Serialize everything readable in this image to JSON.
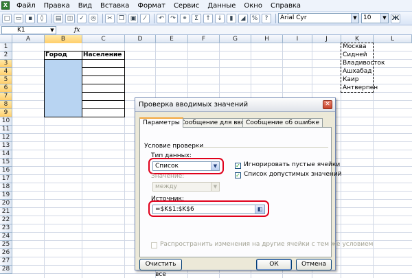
{
  "menubar": {
    "app_icon": "excel-icon",
    "items": [
      "Файл",
      "Правка",
      "Вид",
      "Вставка",
      "Формат",
      "Сервис",
      "Данные",
      "Окно",
      "Справка"
    ]
  },
  "toolbar": {
    "font_name": "Arial Cyr",
    "font_size": "10",
    "sigma": "Σ",
    "bold": "Ж"
  },
  "formula_bar": {
    "name_box": "K1",
    "fx": "fx"
  },
  "grid": {
    "columns": [
      "A",
      "B",
      "C",
      "D",
      "E",
      "F",
      "G",
      "H",
      "I",
      "J",
      "K",
      "L"
    ],
    "selected_column": "B",
    "rows": [
      "1",
      "2",
      "3",
      "4",
      "5",
      "6",
      "7",
      "8",
      "9",
      "10",
      "11",
      "12",
      "13",
      "14",
      "15",
      "16",
      "17",
      "18",
      "19",
      "20",
      "21",
      "22",
      "23"
    ],
    "header_city": "Город",
    "header_population": "Население",
    "list_cities": [
      "Москва",
      "Сидней",
      "Владивосток",
      "Ашхабад",
      "Каир",
      "Антверпен"
    ]
  },
  "dialog": {
    "title": "Проверка вводимых значений",
    "tabs": [
      "Параметры",
      "Сообщение для ввода",
      "Сообщение об ошибке"
    ],
    "section_label": "Условие проверки",
    "type_label": "Тип данных:",
    "type_value": "Список",
    "value_label": "Значение:",
    "value_value": "между",
    "ignore_blank_label": "Игнорировать пустые ячейки",
    "dropdown_list_label": "Список допустимых значений",
    "source_label": "Источник:",
    "source_value": "=$K$1:$K$6",
    "apply_all_label": "Распространить изменения на другие ячейки с тем же условием",
    "clear_all_label": "Очистить все",
    "ok_label": "ОК",
    "cancel_label": "Отмена"
  },
  "colors": {
    "highlight_red": "#e0001b",
    "selected_cells": "#b8d4f2",
    "dialog_bg": "#ece9d8"
  }
}
